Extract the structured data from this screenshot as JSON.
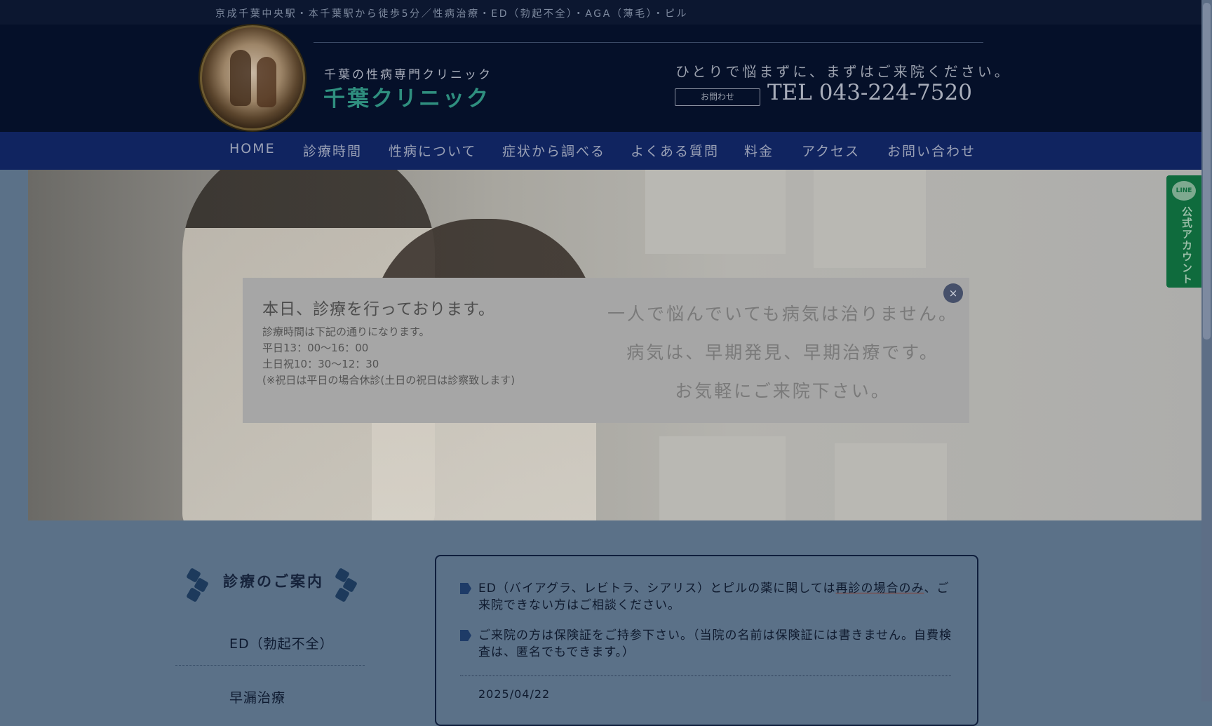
{
  "topbar": {
    "text": "京成千葉中央駅・本千葉駅から徒歩5分／性病治療・ED（勃起不全）・AGA（薄毛）・ピル"
  },
  "header": {
    "subtitle": "千葉の性病専門クリニック",
    "name": "千葉クリニック",
    "tagline": "ひとりで悩まずに、まずはご来院ください。",
    "contact_button": "お問わせ",
    "tel": "TEL 043-224-7520"
  },
  "nav": {
    "items": [
      {
        "label": "HOME"
      },
      {
        "label": "診療時間"
      },
      {
        "label": "性病について"
      },
      {
        "label": "症状から調べる"
      },
      {
        "label": "よくある質問"
      },
      {
        "label": "料金"
      },
      {
        "label": "アクセス"
      },
      {
        "label": "お問い合わせ"
      }
    ]
  },
  "modal": {
    "close": "×",
    "title": "本日、診療を行っております。",
    "lines": [
      "診療時間は下記の通りになります。",
      "平日13：00〜16：00",
      "土日祝10：30〜12：30",
      "(※祝日は平日の場合休診(土日の祝日は診察致します)"
    ],
    "message": [
      "一人で悩んでいても病気は治りません。",
      "病気は、早期発見、早期治療です。",
      "お気軽にご来院下さい。"
    ]
  },
  "sidebar": {
    "title": "診療のご案内",
    "items": [
      {
        "label": "ED（勃起不全）"
      },
      {
        "label": "早漏治療"
      }
    ]
  },
  "notice": {
    "item1_pre": "ED（バイアグラ、レビトラ、シアリス）とピルの薬に関しては",
    "item1_underline": "再診の場合のみ",
    "item1_post": "、ご来院できない方はご相談ください。",
    "item2": "ご来院の方は保険証をご持参下さい。（当院の名前は保険証には書きません。自費検査は、匿名でもできます。）",
    "date": "2025/04/22"
  },
  "line_tab": {
    "badge": "LINE",
    "label": "公式アカウント"
  },
  "colors": {
    "accent_green": "#2f8f7f",
    "nav_bg": "#102460",
    "header_bg": "#051029",
    "line_green": "#0f6b3d"
  },
  "icons": {
    "close": "close-icon",
    "bullet": "arrow-tag-icon",
    "hex": "hexagon-icon"
  }
}
